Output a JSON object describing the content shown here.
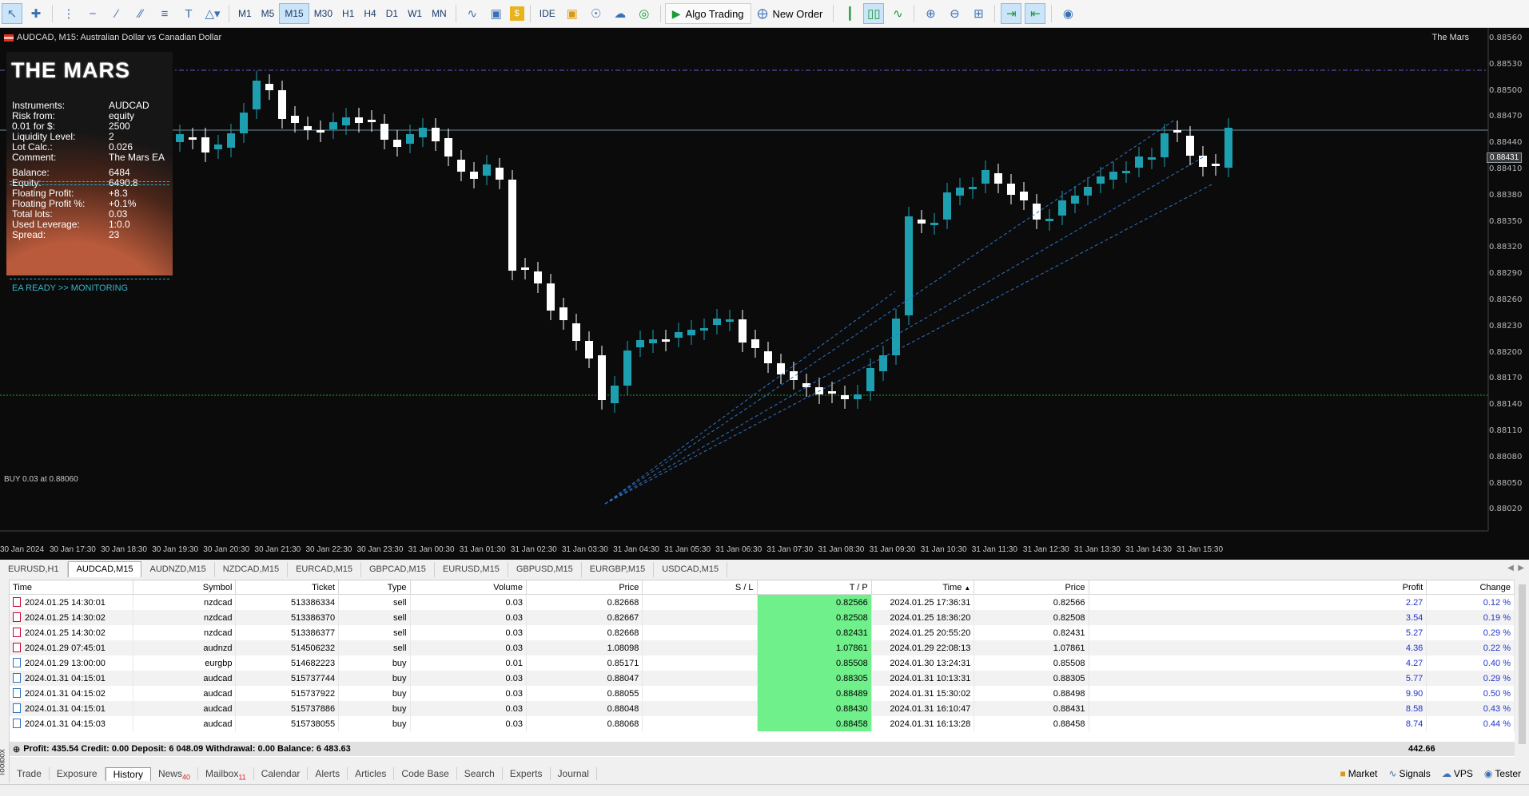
{
  "toolbar": {
    "timeframes": [
      "M1",
      "M5",
      "M15",
      "M30",
      "H1",
      "H4",
      "D1",
      "W1",
      "MN"
    ],
    "active_timeframe": "M15",
    "ide_label": "IDE",
    "algo_label": "Algo Trading",
    "new_order_label": "New Order"
  },
  "chart": {
    "title": "AUDCAD, M15:  Australian Dollar vs Canadian Dollar",
    "ea_name": "The Mars",
    "current_price": "0.88431",
    "buy_label": "BUY 0.03 at 0.88060",
    "price_labels": [
      "0.88560",
      "0.88530",
      "0.88500",
      "0.88470",
      "0.88440",
      "0.88410",
      "0.88380",
      "0.88350",
      "0.88320",
      "0.88290",
      "0.88260",
      "0.88230",
      "0.88200",
      "0.88170",
      "0.88140",
      "0.88110",
      "0.88080",
      "0.88050",
      "0.88020"
    ],
    "time_labels": [
      "30 Jan 2024",
      "30 Jan 17:30",
      "30 Jan 18:30",
      "30 Jan 19:30",
      "30 Jan 20:30",
      "30 Jan 21:30",
      "30 Jan 22:30",
      "30 Jan 23:30",
      "31 Jan 00:30",
      "31 Jan 01:30",
      "31 Jan 02:30",
      "31 Jan 03:30",
      "31 Jan 04:30",
      "31 Jan 05:30",
      "31 Jan 06:30",
      "31 Jan 07:30",
      "31 Jan 08:30",
      "31 Jan 09:30",
      "31 Jan 10:30",
      "31 Jan 11:30",
      "31 Jan 12:30",
      "31 Jan 13:30",
      "31 Jan 14:30",
      "31 Jan 15:30"
    ],
    "colors": {
      "bull": "#1e9fb0",
      "bear": "#ffffff",
      "background": "#0b0b0b"
    }
  },
  "ea_panel": {
    "title": "THE MARS",
    "rows": [
      {
        "label": "Instruments:",
        "value": "AUDCAD"
      },
      {
        "label": "Risk from:",
        "value": "equity"
      },
      {
        "label": "0.01 for $:",
        "value": "2500"
      },
      {
        "label": "Liquidity Level:",
        "value": "2"
      },
      {
        "label": "Lot Calc.:",
        "value": "0.026"
      },
      {
        "label": "Comment:",
        "value": "The Mars EA"
      },
      {
        "label": "Balance:",
        "value": "6484"
      },
      {
        "label": "Equity:",
        "value": "6490.8"
      },
      {
        "label": "Floating Profit:",
        "value": "+8.3"
      },
      {
        "label": "Floating Profit %:",
        "value": "+0.1%"
      },
      {
        "label": "Total lots:",
        "value": "0.03"
      },
      {
        "label": "Used Leverage:",
        "value": "1:0.0"
      },
      {
        "label": "Spread:",
        "value": "23"
      }
    ],
    "status": "EA READY >> MONITORING"
  },
  "chart_tabs": [
    "EURUSD,H1",
    "AUDCAD,M15",
    "AUDNZD,M15",
    "NZDCAD,M15",
    "EURCAD,M15",
    "GBPCAD,M15",
    "EURUSD,M15",
    "GBPUSD,M15",
    "EURGBP,M15",
    "USDCAD,M15"
  ],
  "history": {
    "columns": [
      "Time",
      "Symbol",
      "Ticket",
      "Type",
      "Volume",
      "Price",
      "S / L",
      "T / P",
      "Time",
      "Price",
      "Profit",
      "Change"
    ],
    "rows": [
      {
        "time": "2024.01.25 14:30:01",
        "symbol": "nzdcad",
        "ticket": "513386334",
        "type": "sell",
        "volume": "0.03",
        "price": "0.82668",
        "sl": "",
        "tp": "0.82566",
        "close_time": "2024.01.25 17:36:31",
        "close_price": "0.82566",
        "profit": "2.27",
        "change": "0.12 %"
      },
      {
        "time": "2024.01.25 14:30:02",
        "symbol": "nzdcad",
        "ticket": "513386370",
        "type": "sell",
        "volume": "0.03",
        "price": "0.82667",
        "sl": "",
        "tp": "0.82508",
        "close_time": "2024.01.25 18:36:20",
        "close_price": "0.82508",
        "profit": "3.54",
        "change": "0.19 %"
      },
      {
        "time": "2024.01.25 14:30:02",
        "symbol": "nzdcad",
        "ticket": "513386377",
        "type": "sell",
        "volume": "0.03",
        "price": "0.82668",
        "sl": "",
        "tp": "0.82431",
        "close_time": "2024.01.25 20:55:20",
        "close_price": "0.82431",
        "profit": "5.27",
        "change": "0.29 %"
      },
      {
        "time": "2024.01.29 07:45:01",
        "symbol": "audnzd",
        "ticket": "514506232",
        "type": "sell",
        "volume": "0.03",
        "price": "1.08098",
        "sl": "",
        "tp": "1.07861",
        "close_time": "2024.01.29 22:08:13",
        "close_price": "1.07861",
        "profit": "4.36",
        "change": "0.22 %"
      },
      {
        "time": "2024.01.29 13:00:00",
        "symbol": "eurgbp",
        "ticket": "514682223",
        "type": "buy",
        "volume": "0.01",
        "price": "0.85171",
        "sl": "",
        "tp": "0.85508",
        "close_time": "2024.01.30 13:24:31",
        "close_price": "0.85508",
        "profit": "4.27",
        "change": "0.40 %"
      },
      {
        "time": "2024.01.31 04:15:01",
        "symbol": "audcad",
        "ticket": "515737744",
        "type": "buy",
        "volume": "0.03",
        "price": "0.88047",
        "sl": "",
        "tp": "0.88305",
        "close_time": "2024.01.31 10:13:31",
        "close_price": "0.88305",
        "profit": "5.77",
        "change": "0.29 %"
      },
      {
        "time": "2024.01.31 04:15:02",
        "symbol": "audcad",
        "ticket": "515737922",
        "type": "buy",
        "volume": "0.03",
        "price": "0.88055",
        "sl": "",
        "tp": "0.88489",
        "close_time": "2024.01.31 15:30:02",
        "close_price": "0.88498",
        "profit": "9.90",
        "change": "0.50 %"
      },
      {
        "time": "2024.01.31 04:15:01",
        "symbol": "audcad",
        "ticket": "515737886",
        "type": "buy",
        "volume": "0.03",
        "price": "0.88048",
        "sl": "",
        "tp": "0.88430",
        "close_time": "2024.01.31 16:10:47",
        "close_price": "0.88431",
        "profit": "8.58",
        "change": "0.43 %"
      },
      {
        "time": "2024.01.31 04:15:03",
        "symbol": "audcad",
        "ticket": "515738055",
        "type": "buy",
        "volume": "0.03",
        "price": "0.88068",
        "sl": "",
        "tp": "0.88458",
        "close_time": "2024.01.31 16:13:28",
        "close_price": "0.88458",
        "profit": "8.74",
        "change": "0.44 %"
      }
    ],
    "summary": "Profit: 435.54  Credit: 0.00  Deposit: 6 048.09  Withdrawal: 0.00  Balance: 6 483.63",
    "total": "442.66"
  },
  "bottom_tabs": [
    {
      "label": "Trade",
      "badge": ""
    },
    {
      "label": "Exposure",
      "badge": ""
    },
    {
      "label": "History",
      "badge": ""
    },
    {
      "label": "News",
      "badge": "40"
    },
    {
      "label": "Mailbox",
      "badge": "11"
    },
    {
      "label": "Calendar",
      "badge": ""
    },
    {
      "label": "Alerts",
      "badge": ""
    },
    {
      "label": "Articles",
      "badge": ""
    },
    {
      "label": "Code Base",
      "badge": ""
    },
    {
      "label": "Search",
      "badge": ""
    },
    {
      "label": "Experts",
      "badge": ""
    },
    {
      "label": "Journal",
      "badge": ""
    }
  ],
  "right_tabs": [
    "Market",
    "Signals",
    "VPS",
    "Tester"
  ],
  "toolbox_label": "Toolbox"
}
